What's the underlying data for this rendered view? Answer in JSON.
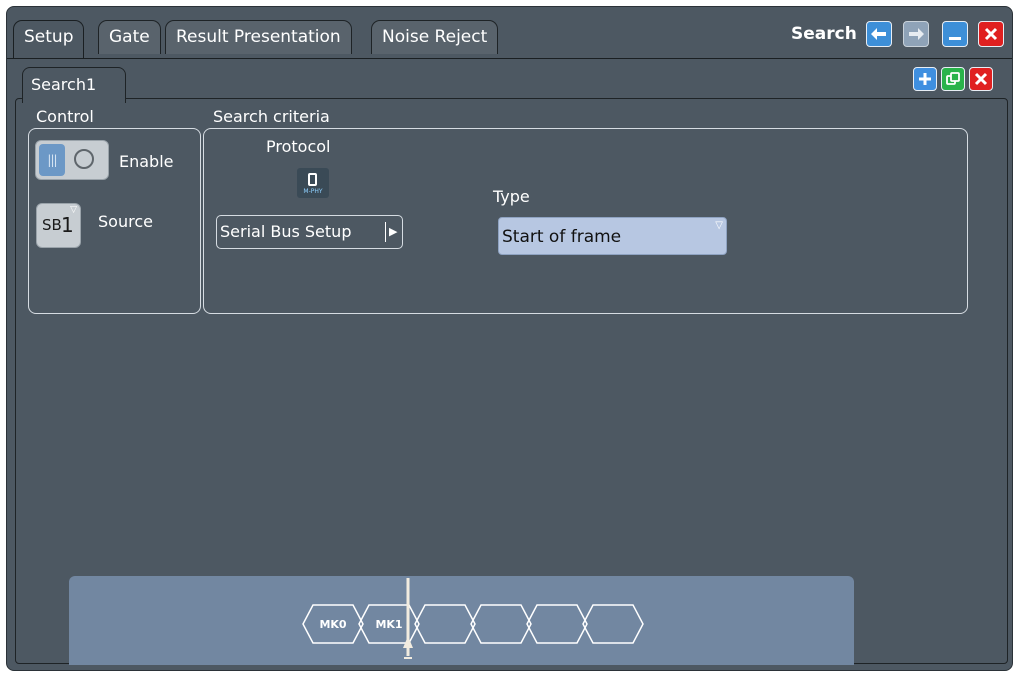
{
  "tabs": [
    "Setup",
    "Gate",
    "Result Presentation",
    "Noise Reject"
  ],
  "window": {
    "title": "Search"
  },
  "search_tab": "Search1",
  "control": {
    "heading": "Control",
    "enable_label": "Enable",
    "enabled": true,
    "source_label": "Source",
    "source_prefix": "SB",
    "source_number": "1"
  },
  "criteria": {
    "heading": "Search criteria",
    "protocol_label": "Protocol",
    "protocol_icon_text": "M-PHY",
    "serial_bus_button": "Serial Bus Setup",
    "type_label": "Type",
    "type_value": "Start of frame"
  },
  "timeline": {
    "markers": [
      "MK0",
      "MK1",
      "",
      "",
      "",
      ""
    ]
  },
  "colors": {
    "background": "#4d5862",
    "close_red": "#e02020",
    "add_blue": "#3f8fe0",
    "copy_green": "#29b34a",
    "minimize_blue": "#3d8fd8",
    "strip": "#7287a1",
    "type_box": "#b7c7e2"
  }
}
